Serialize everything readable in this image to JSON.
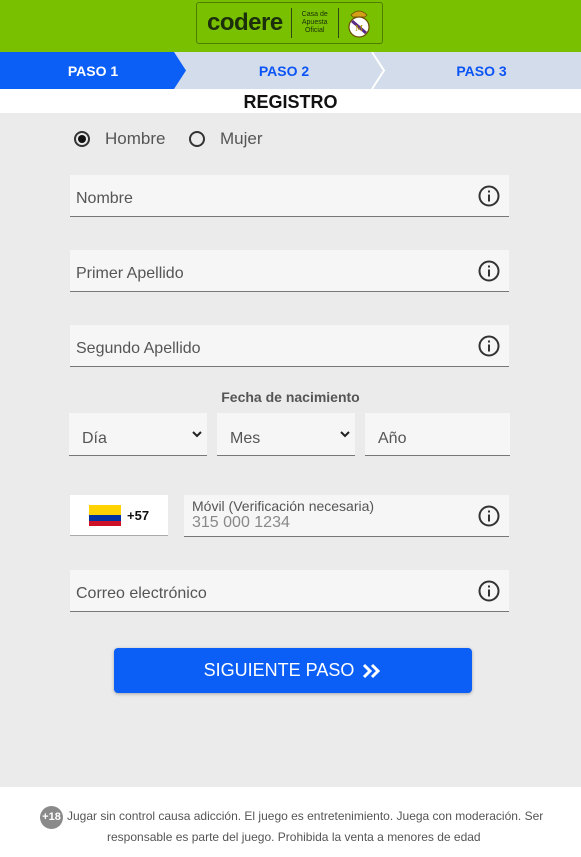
{
  "brand": {
    "logo_text": "codere",
    "tagline_lines": [
      "Casa de",
      "Apuesta",
      "Oficial"
    ],
    "colors": {
      "header_green": "#79c000",
      "step_active": "#0b5ff7",
      "step_inactive": "#d3dcea",
      "primary_button": "#0b5ff7"
    }
  },
  "steps": [
    {
      "label": "PASO 1",
      "active": true
    },
    {
      "label": "PASO 2",
      "active": false
    },
    {
      "label": "PASO 3",
      "active": false
    }
  ],
  "page_title": "REGISTRO",
  "gender": {
    "options": [
      {
        "label": "Hombre",
        "selected": true
      },
      {
        "label": "Mujer",
        "selected": false
      }
    ]
  },
  "fields": {
    "first_name": {
      "placeholder": "Nombre",
      "icon": "info-icon"
    },
    "last_name_1": {
      "placeholder": "Primer Apellido",
      "icon": "info-icon"
    },
    "last_name_2": {
      "placeholder": "Segundo Apellido",
      "icon": "info-icon"
    },
    "email": {
      "placeholder": "Correo electrónico",
      "icon": "info-icon"
    }
  },
  "dob": {
    "label": "Fecha de nacimiento",
    "day": "Día",
    "month": "Mes",
    "year": "Año"
  },
  "phone": {
    "country_code": "+57",
    "flag": "colombia-flag",
    "label": "Móvil (Verificación necesaria)",
    "placeholder": "315 000 1234"
  },
  "next_button": {
    "label": "SIGUIENTE PASO",
    "icon": "double-chevron-right-icon"
  },
  "footer": {
    "age_badge": "+18",
    "line1": "Jugar sin control causa adicción. El juego es entretenimiento. Juega con moderación. Ser",
    "line2": "responsable es parte del juego. Prohibida la venta a menores de edad"
  }
}
